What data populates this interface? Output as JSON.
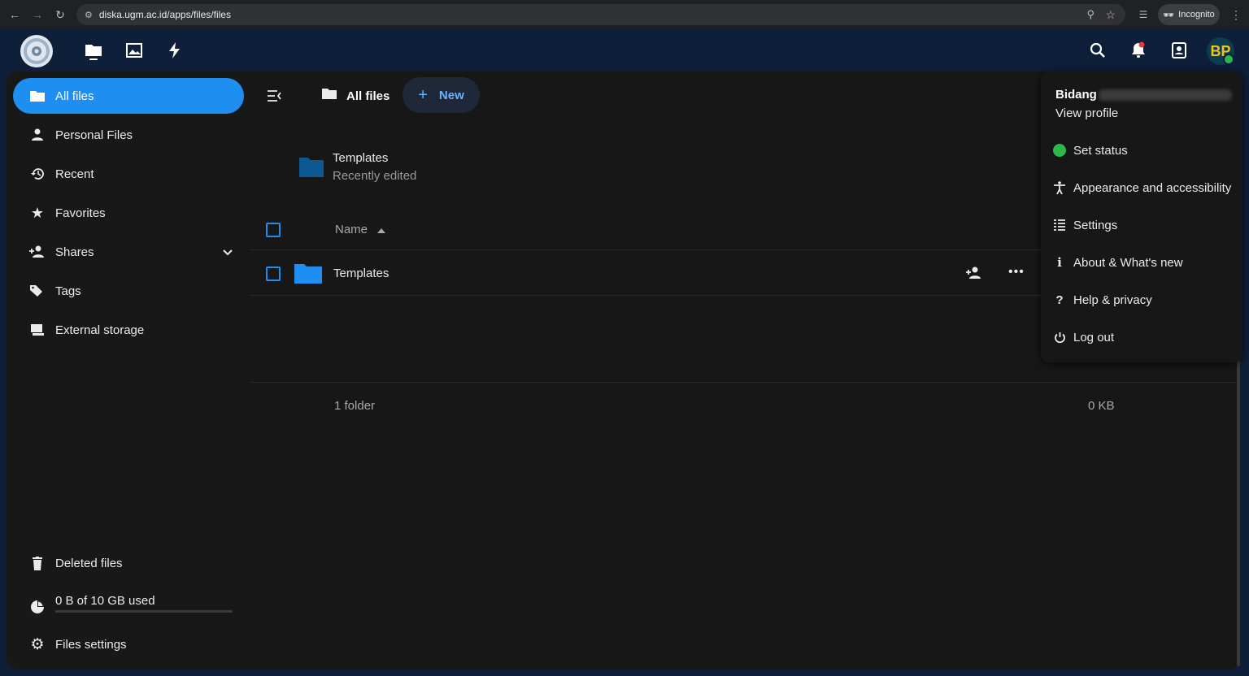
{
  "browser": {
    "url": "diska.ugm.ac.id/apps/files/files",
    "incognito_label": "Incognito"
  },
  "navigation": {
    "items": [
      {
        "label": "All files"
      },
      {
        "label": "Personal Files"
      },
      {
        "label": "Recent"
      },
      {
        "label": "Favorites"
      },
      {
        "label": "Shares"
      },
      {
        "label": "Tags"
      },
      {
        "label": "External storage"
      }
    ],
    "deleted_label": "Deleted files",
    "quota_label": "0 B of 10 GB used",
    "quota_used_fraction": 0,
    "settings_label": "Files settings"
  },
  "breadcrumb": {
    "current": "All files",
    "new_button": "New"
  },
  "recent": {
    "name": "Templates",
    "subtitle": "Recently edited"
  },
  "table": {
    "header_name": "Name",
    "rows": [
      {
        "name": "Templates"
      }
    ],
    "summary_count": "1 folder",
    "summary_size": "0 KB"
  },
  "user_menu": {
    "name": "Bidang",
    "view_profile": "View profile",
    "items": [
      {
        "label": "Set status"
      },
      {
        "label": "Appearance and accessibility"
      },
      {
        "label": "Settings"
      },
      {
        "label": "About & What's new"
      },
      {
        "label": "Help & privacy"
      },
      {
        "label": "Log out"
      }
    ]
  },
  "avatar_initials": "BP",
  "colors": {
    "primary": "#1e8ef0",
    "header": "#0e1f3a",
    "status_online": "#2db84d"
  }
}
